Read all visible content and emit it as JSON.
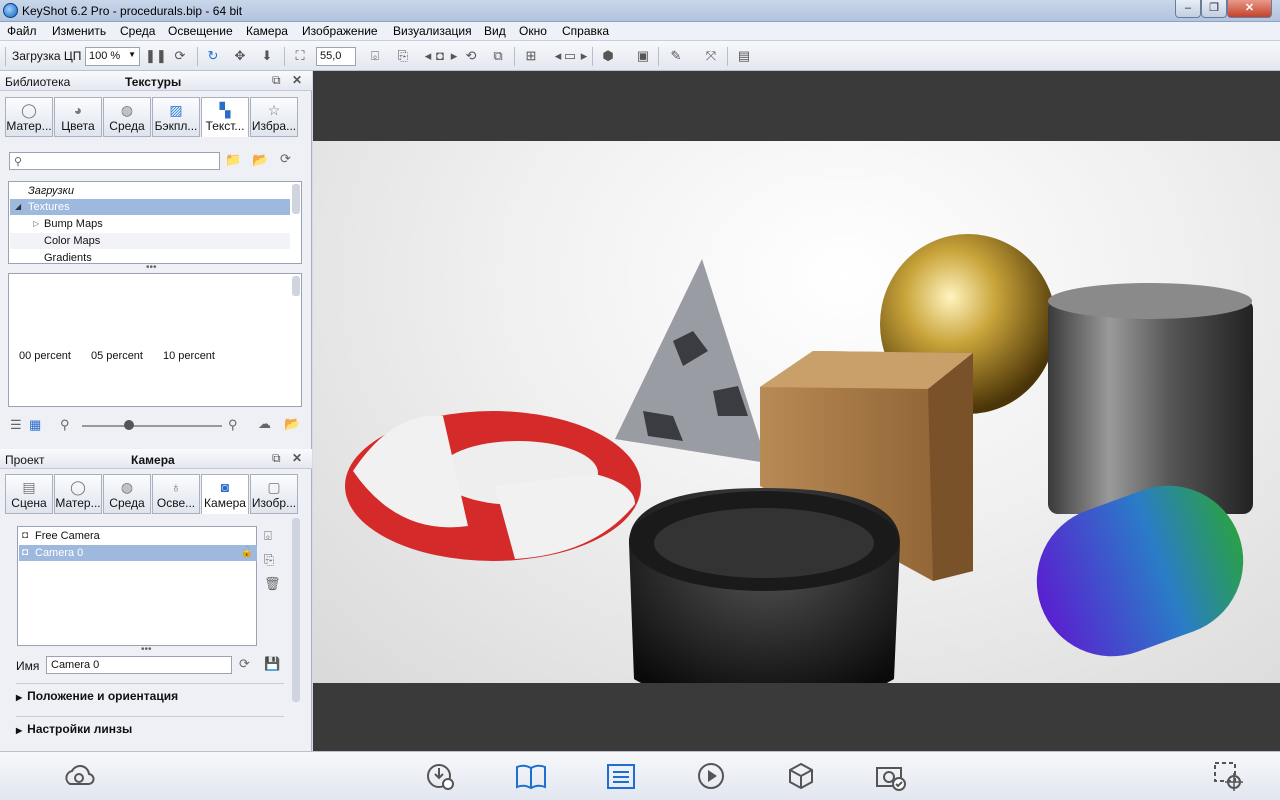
{
  "window": {
    "title": "KeyShot 6.2 Pro  -  procedurals.bip  - 64 bit",
    "min": "‒",
    "max": "❐",
    "close": "✕"
  },
  "menu": [
    "Файл",
    "Изменить",
    "Среда",
    "Освещение",
    "Камера",
    "Изображение",
    "Визуализация",
    "Вид",
    "Окно",
    "Справка"
  ],
  "toolbar": {
    "cpu_label": "Загрузка ЦП",
    "cpu_value": "100 %",
    "fov_value": "55,0"
  },
  "library": {
    "header_left": "Библиотека",
    "header_center": "Текстуры",
    "tabs": [
      "Матер...",
      "Цвета",
      "Среда",
      "Бэкпл...",
      "Текст...",
      "Избра..."
    ],
    "search_placeholder": "",
    "tree": [
      "Загрузки",
      "Textures",
      "Bump Maps",
      "Color Maps",
      "Gradients"
    ],
    "thumbs": [
      "00 percent",
      "05 percent",
      "10 percent"
    ]
  },
  "project": {
    "header_left": "Проект",
    "header_center": "Камера",
    "tabs": [
      "Сцена",
      "Матер...",
      "Среда",
      "Осве...",
      "Камера",
      "Изобр..."
    ],
    "cameras": [
      "Free Camera",
      "Camera 0"
    ],
    "name_label": "Имя",
    "name_value": "Camera 0",
    "sections": [
      "Положение и ориентация",
      "Настройки линзы"
    ]
  },
  "colors": {
    "accent": "#1e6fd0",
    "selection": "#9eb9dd"
  }
}
